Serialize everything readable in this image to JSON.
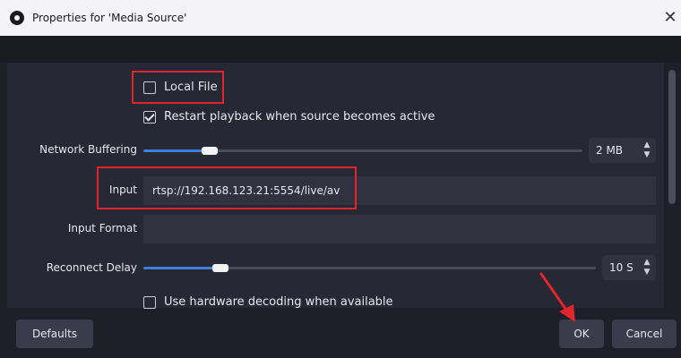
{
  "window": {
    "title": "Properties for 'Media Source'",
    "close_glyph": "✕"
  },
  "form": {
    "local_file": {
      "label": "Local File",
      "checked": false
    },
    "restart_playback": {
      "label": "Restart playback when source becomes active",
      "checked": true
    },
    "network_buffering": {
      "label": "Network Buffering",
      "value": "2 MB",
      "slider_fraction": 0.15
    },
    "input": {
      "label": "Input",
      "value": "rtsp://192.168.123.21:5554/live/av"
    },
    "input_format": {
      "label": "Input Format",
      "value": ""
    },
    "reconnect_delay": {
      "label": "Reconnect Delay",
      "value": "10 S",
      "slider_fraction": 0.17
    },
    "hardware_decoding": {
      "label": "Use hardware decoding when available",
      "checked": false
    }
  },
  "buttons": {
    "defaults": "Defaults",
    "ok": "OK",
    "cancel": "Cancel"
  },
  "annotations": {
    "highlight_color": "#e0252f"
  },
  "spin_arrows": "⌃\n⌄",
  "icons": [
    "obs-app-icon",
    "close-icon",
    "spin-arrows-icon",
    "checkmark-icon",
    "pointer-arrow-icon"
  ]
}
